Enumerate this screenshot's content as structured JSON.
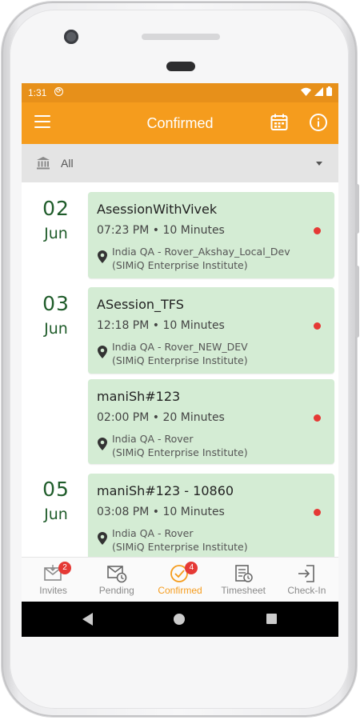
{
  "status_bar": {
    "time": "1:31",
    "icons": [
      "sync-icon",
      "wifi-icon",
      "signal-icon",
      "battery-icon"
    ]
  },
  "app_bar": {
    "title": "Confirmed",
    "icons": [
      "menu-icon",
      "calendar-icon",
      "info-icon"
    ]
  },
  "filter": {
    "label": "All",
    "icon": "bank-icon"
  },
  "groups": [
    {
      "day": "02",
      "month": "Jun",
      "sessions": [
        {
          "title": "AsessionWithVivek",
          "time": "07:23 PM • 10 Minutes",
          "location_line1": "India QA - Rover_Akshay_Local_Dev",
          "location_line2": "(SIMiQ Enterprise Institute)"
        }
      ]
    },
    {
      "day": "03",
      "month": "Jun",
      "sessions": [
        {
          "title": "ASession_TFS",
          "time": "12:18 PM • 10 Minutes",
          "location_line1": "India QA - Rover_NEW_DEV",
          "location_line2": "(SIMiQ Enterprise Institute)"
        },
        {
          "title": "maniSh#123",
          "time": "02:00 PM • 20 Minutes",
          "location_line1": "India QA - Rover",
          "location_line2": "(SIMiQ Enterprise Institute)"
        }
      ]
    },
    {
      "day": "05",
      "month": "Jun",
      "sessions": [
        {
          "title": "maniSh#123 - 10860",
          "time": "03:08 PM • 10 Minutes",
          "location_line1": "India QA - Rover",
          "location_line2": "(SIMiQ Enterprise Institute)"
        }
      ]
    }
  ],
  "bottom_nav": [
    {
      "label": "Invites",
      "badge": "2",
      "icon": "invites-icon"
    },
    {
      "label": "Pending",
      "badge": "",
      "icon": "pending-icon"
    },
    {
      "label": "Confirmed",
      "badge": "4",
      "icon": "confirmed-icon",
      "active": true
    },
    {
      "label": "Timesheet",
      "badge": "",
      "icon": "timesheet-icon"
    },
    {
      "label": "Check-In",
      "badge": "",
      "icon": "check-in-icon"
    }
  ],
  "colors": {
    "accent": "#f59c1d",
    "status_bar": "#e7901a",
    "card_bg": "#d4ecd4",
    "date_text": "#1f5c2a",
    "status_dot": "#e53935"
  }
}
